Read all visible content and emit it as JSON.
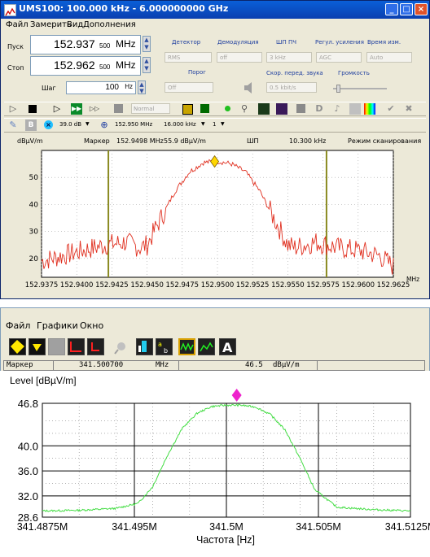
{
  "win1": {
    "title": "UMS100: 100.000 kHz - 6.000000000 GHz",
    "menu": [
      "Файл",
      "Замерить",
      "Вид",
      "Дополнения"
    ],
    "start": {
      "label": "Пуск",
      "main": "152.937",
      "sub": "500",
      "unit": "MHz"
    },
    "stop": {
      "label": "Стоп",
      "main": "152.962",
      "sub": "500",
      "unit": "MHz"
    },
    "step": {
      "label": "Шаг",
      "value": "100",
      "unit": "Hz"
    },
    "params": {
      "detector": {
        "label": "Детектор",
        "value": "RMS"
      },
      "demod": {
        "label": "Демодуляция",
        "value": "off"
      },
      "if_bw": {
        "label": "ШП ПЧ",
        "value": "3 kHz"
      },
      "gain": {
        "label": "Регул. усиления",
        "value": "AGC"
      },
      "meas_time": {
        "label": "Время изм.",
        "value": "Auto"
      },
      "threshold": {
        "label": "Порог",
        "value": "Off"
      },
      "audio_rate": {
        "label": "Скор. перед. звука",
        "value": "0.5 kbit/s"
      },
      "volume": {
        "label": "Громкость"
      }
    },
    "toolbar1": {
      "mode": "Normal"
    },
    "toolbar2": {
      "level": "39.0 dB",
      "freq": "152.950 MHz",
      "span": "16.000 kHz",
      "count": "1"
    },
    "status": {
      "unit": "dBµV/m",
      "marker_label": "Маркер",
      "marker_freq": "152.9498 MHz",
      "marker_level": "55.9 dBµV/m",
      "bw_label": "ШП",
      "bw_value": "10.300 kHz",
      "mode": "Режим сканирования"
    },
    "colors": {
      "trace": "#e03020",
      "marker_lines": "#8a8a20",
      "marker": "#ffd700"
    }
  },
  "win2": {
    "menu": [
      "Файл",
      "Графики",
      "Окно"
    ],
    "marker_bar": {
      "label": "Маркер",
      "freq": "341.500700",
      "freq_unit": "MHz",
      "level": "46.5",
      "level_unit": "dBµV/m"
    },
    "colors": {
      "trace": "#44dd44",
      "marker": "#ee22cc"
    }
  },
  "chart_data": [
    {
      "type": "line",
      "x_ticks": [
        "152.9375",
        "152.9400",
        "152.9425",
        "152.9450",
        "152.9475",
        "152.9500",
        "152.9525",
        "152.9550",
        "152.9575",
        "152.9600",
        "152.9625"
      ],
      "xlabel": "MHz",
      "ylabel": "",
      "y_ticks": [
        "20",
        "30",
        "40",
        "50"
      ],
      "xlim": [
        152.9375,
        152.9625
      ],
      "ylim": [
        13,
        60
      ],
      "marker_lines": [
        152.94225,
        152.95775
      ],
      "marker": {
        "x": 152.9498,
        "y": 55.9
      },
      "series": [
        {
          "x": [
            152.9375,
            152.939,
            152.9405,
            152.942,
            152.9435,
            152.9445,
            152.945,
            152.946,
            152.947,
            152.948,
            152.949,
            152.95,
            152.951,
            152.952,
            152.953,
            152.954,
            152.955,
            152.9555,
            152.957,
            152.9585,
            152.96,
            152.9615,
            152.9625
          ],
          "y": [
            19,
            21,
            23,
            25,
            26,
            24,
            25,
            35,
            45,
            52,
            55.5,
            56,
            55,
            52,
            45,
            35,
            25,
            24,
            26,
            24,
            23,
            21,
            17
          ]
        }
      ]
    },
    {
      "type": "line",
      "title": "",
      "ylabel": "Level  [dBµV/m]",
      "xlabel": "Частота [Hz]",
      "x_ticks": [
        "341.4875M",
        "341.495M",
        "341.5M",
        "341.505M",
        "341.5125M"
      ],
      "y_ticks": [
        "28.6",
        "32.0",
        "36.0",
        "40.0",
        "46.8"
      ],
      "xlim": [
        341.4875,
        341.5125
      ],
      "ylim": [
        28.6,
        46.8
      ],
      "marker": {
        "x": 341.5007,
        "y": 46.5
      },
      "series": [
        {
          "x": [
            341.4875,
            341.49,
            341.4925,
            341.494,
            341.495,
            341.496,
            341.497,
            341.498,
            341.499,
            341.5,
            341.501,
            341.502,
            341.503,
            341.504,
            341.505,
            341.506,
            341.5075,
            341.51,
            341.5125
          ],
          "y": [
            29.6,
            29.7,
            30.0,
            30.8,
            33.5,
            38.5,
            42.8,
            45.2,
            46.3,
            46.5,
            46.5,
            46.2,
            45.0,
            42.5,
            38.0,
            33.0,
            30.2,
            29.8,
            29.6
          ]
        }
      ]
    }
  ]
}
